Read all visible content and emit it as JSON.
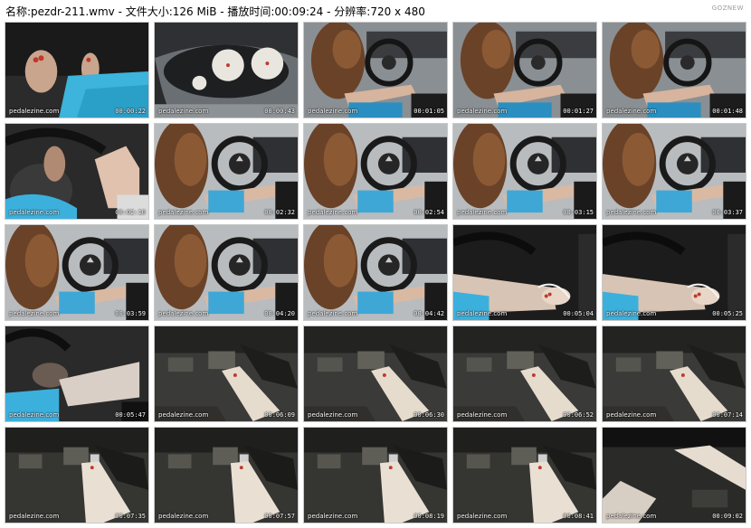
{
  "header": {
    "text": "名称:pezdr-211.wmv - 文件大小:126 MiB - 播放时间:00:09:24 - 分辨率:720 x 480"
  },
  "logo": "GOZNEW",
  "thumbnails": [
    {
      "scene": "feet-red-nails",
      "watermark": "pedalezine.com",
      "time": "00:00:22"
    },
    {
      "scene": "dashboard-gauges",
      "watermark": "pedalezine.com",
      "time": "00:00:43"
    },
    {
      "scene": "driver-wide",
      "watermark": "pedalezine.com",
      "time": "00:01:05"
    },
    {
      "scene": "driver-wide",
      "watermark": "pedalezine.com",
      "time": "00:01:27"
    },
    {
      "scene": "driver-wide",
      "watermark": "pedalezine.com",
      "time": "00:01:48"
    },
    {
      "scene": "hand-closeup",
      "watermark": "pedalezine.com",
      "time": "00:02:10"
    },
    {
      "scene": "driver-wheel",
      "watermark": "pedalezine.com",
      "time": "00:02:32"
    },
    {
      "scene": "driver-wheel",
      "watermark": "pedalezine.com",
      "time": "00:02:54"
    },
    {
      "scene": "driver-wheel",
      "watermark": "pedalezine.com",
      "time": "00:03:15"
    },
    {
      "scene": "driver-wheel",
      "watermark": "pedalezine.com",
      "time": "00:03:37"
    },
    {
      "scene": "driver-wheel",
      "watermark": "pedalezine.com",
      "time": "00:03:59"
    },
    {
      "scene": "driver-wheel",
      "watermark": "pedalezine.com",
      "time": "00:04:20"
    },
    {
      "scene": "driver-wheel",
      "watermark": "pedalezine.com",
      "time": "00:04:42"
    },
    {
      "scene": "leg-sandal",
      "watermark": "pedalezine.com",
      "time": "00:05:04"
    },
    {
      "scene": "leg-sandal",
      "watermark": "pedalezine.com",
      "time": "00:05:25"
    },
    {
      "scene": "leg-dark",
      "watermark": "pedalezine.com",
      "time": "00:05:47"
    },
    {
      "scene": "pedals-foot",
      "watermark": "pedalezine.com",
      "time": "00:06:09"
    },
    {
      "scene": "pedals-foot",
      "watermark": "pedalezine.com",
      "time": "00:06:30"
    },
    {
      "scene": "pedals-foot",
      "watermark": "pedalezine.com",
      "time": "00:06:52"
    },
    {
      "scene": "pedals-foot",
      "watermark": "pedalezine.com",
      "time": "00:07:14"
    },
    {
      "scene": "pedals-low",
      "watermark": "pedalezine.com",
      "time": "00:07:35"
    },
    {
      "scene": "pedals-low",
      "watermark": "pedalezine.com",
      "time": "00:07:57"
    },
    {
      "scene": "pedals-low",
      "watermark": "pedalezine.com",
      "time": "00:08:19"
    },
    {
      "scene": "pedals-low",
      "watermark": "pedalezine.com",
      "time": "00:08:41"
    },
    {
      "scene": "pedals-dark",
      "watermark": "pedalezine.com",
      "time": "00:09:02"
    }
  ]
}
